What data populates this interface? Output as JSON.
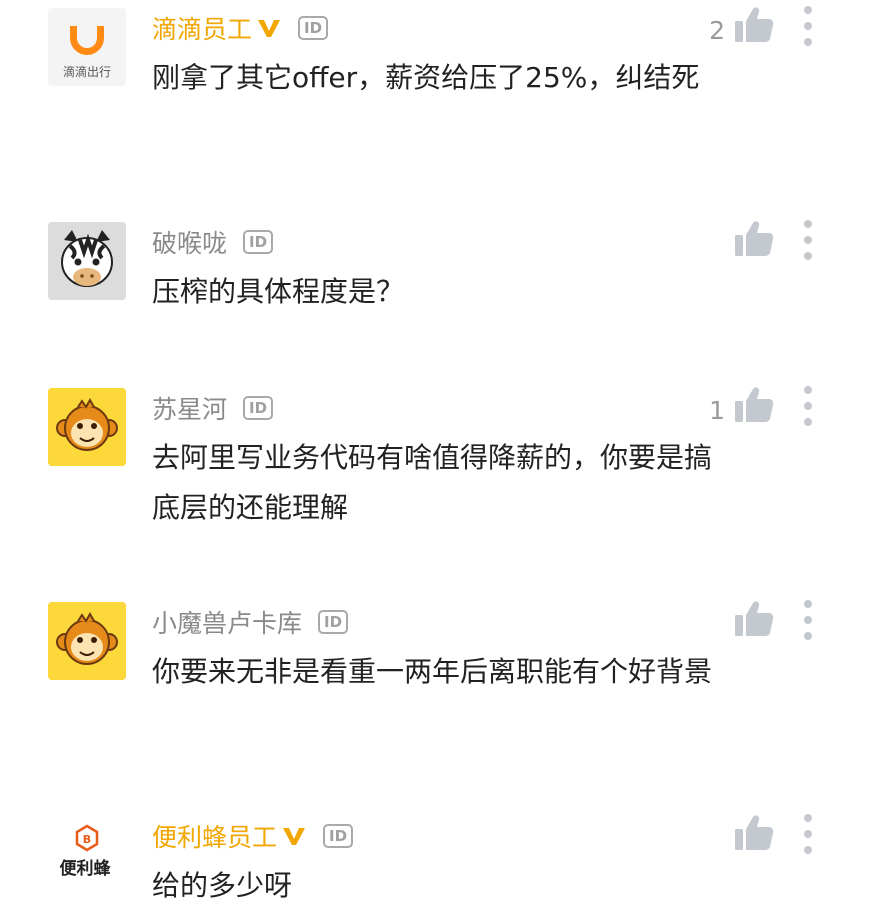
{
  "comments": [
    {
      "name": "滴滴员工",
      "verified": true,
      "id_badge": "ID",
      "avatar": "didi-logo",
      "avatar_caption": "滴滴出行",
      "text": "刚拿了其它offer，薪资给压了25%，纠结死",
      "likes": "2"
    },
    {
      "name": "破喉咙",
      "verified": false,
      "id_badge": "ID",
      "avatar": "zebra-avatar",
      "text": "压榨的具体程度是？",
      "likes": ""
    },
    {
      "name": "苏星河",
      "verified": false,
      "id_badge": "ID",
      "avatar": "monkey-avatar",
      "text": "去阿里写业务代码有啥值得降薪的，你要是搞底层的还能理解",
      "likes": "1"
    },
    {
      "name": "小魔兽卢卡库",
      "verified": false,
      "id_badge": "ID",
      "avatar": "monkey-avatar",
      "text": "你要来无非是看重一两年后离职能有个好背景",
      "likes": ""
    },
    {
      "name": "便利蜂员工",
      "verified": true,
      "id_badge": "ID",
      "avatar": "bianlifeng-logo",
      "avatar_caption": "便利蜂",
      "text": "给的多少呀",
      "likes": ""
    }
  ],
  "colors": {
    "staff_name": "#f2a600",
    "user_name": "#8a8a8a",
    "text": "#222222",
    "icon": "#c4c8cf"
  }
}
